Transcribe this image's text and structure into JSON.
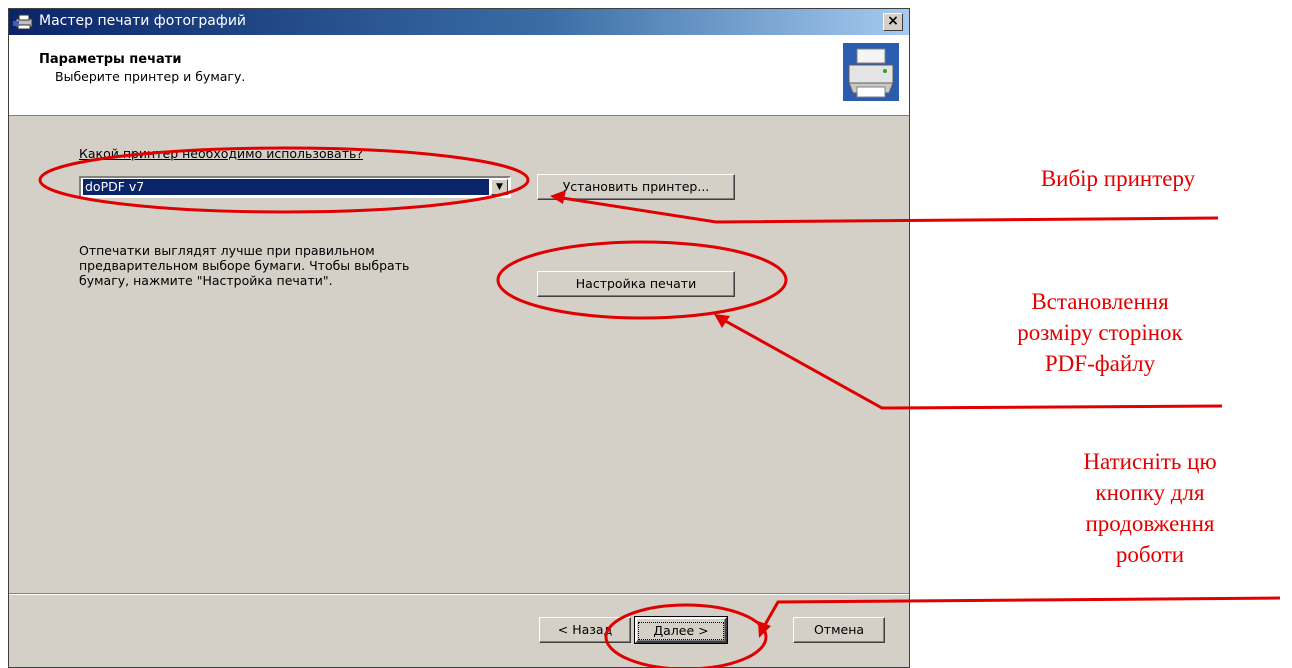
{
  "window": {
    "title": "Мастер печати фотографий",
    "close_glyph": "×"
  },
  "header": {
    "title": "Параметры печати",
    "subtitle": "Выберите принтер и бумагу.",
    "icon": "printer-icon"
  },
  "printer": {
    "question": "Какой принтер необходимо использовать?",
    "selected": "doPDF v7",
    "dropdown_glyph": "▼",
    "install_button": "Установить принтер..."
  },
  "paper": {
    "info_line1": "Отпечатки выглядят лучше при правильном",
    "info_line2": "предварительном выборе бумаги. Чтобы выбрать",
    "info_line3": "бумагу, нажмите \"Настройка печати\".",
    "setup_button": "Настройка печати"
  },
  "footer": {
    "back_button": "< Назад",
    "next_button": "Далее >",
    "cancel_button": "Отмена"
  },
  "annotations": {
    "color": "#e00000",
    "printer_choice": "Вибір принтеру",
    "page_size_line1": "Встановлення",
    "page_size_line2": "розміру сторінок",
    "page_size_line3": "PDF-файлу",
    "continue_line1": "Натисніть цю",
    "continue_line2": "кнопку для",
    "continue_line3": "продовження",
    "continue_line4": "роботи"
  }
}
